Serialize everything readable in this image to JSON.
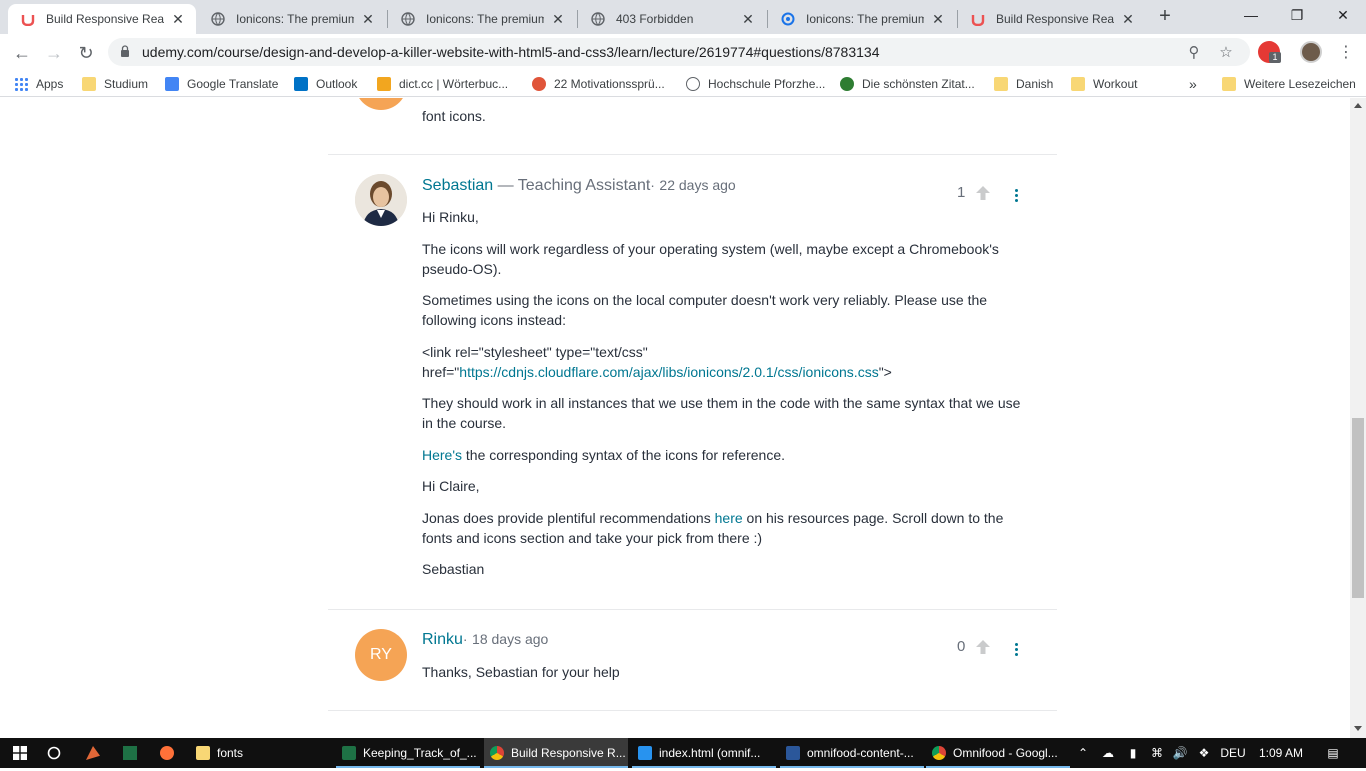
{
  "browser": {
    "tabs": [
      {
        "title": "Build Responsive Real W",
        "icon": "udemy-icon",
        "active": true
      },
      {
        "title": "Ionicons: The premium",
        "icon": "globe-icon",
        "active": false
      },
      {
        "title": "Ionicons: The premium",
        "icon": "globe-icon",
        "active": false
      },
      {
        "title": "403 Forbidden",
        "icon": "globe-icon",
        "active": false
      },
      {
        "title": "Ionicons: The premium",
        "icon": "loading-icon",
        "active": false
      },
      {
        "title": "Build Responsive Real W",
        "icon": "udemy-icon",
        "active": false
      }
    ],
    "url": "udemy.com/course/design-and-develop-a-killer-website-with-html5-and-css3/learn/lecture/2619774#questions/8783134",
    "extension_badge": "1",
    "bookmarks": [
      {
        "label": "Apps",
        "icon": "apps-grid-icon"
      },
      {
        "label": "Studium",
        "icon": "folder-icon"
      },
      {
        "label": "Google Translate",
        "icon": "google-translate-icon"
      },
      {
        "label": "Outlook",
        "icon": "outlook-icon"
      },
      {
        "label": "dict.cc | Wörterbuc...",
        "icon": "dictcc-icon"
      },
      {
        "label": "22 Motivationssprü...",
        "icon": "motivation-icon"
      },
      {
        "label": "Hochschule Pforzhe...",
        "icon": "globe-icon"
      },
      {
        "label": "Die schönsten Zitat...",
        "icon": "zitate-icon"
      },
      {
        "label": "Danish",
        "icon": "folder-icon"
      },
      {
        "label": "Workout",
        "icon": "folder-icon"
      }
    ],
    "bookmarks_overflow": "»",
    "other_bookmarks": "Weitere Lesezeichen"
  },
  "thread": {
    "prev_tail": "font icons.",
    "replies": [
      {
        "author": "Sebastian",
        "role": " — Teaching Assistant",
        "dot": "·",
        "time": "22 days ago",
        "votes": "1",
        "paragraphs": {
          "p1": "Hi Rinku,",
          "p2": "The icons will work regardless of your operating system (well, maybe except a Chromebook's pseudo-OS).",
          "p3": "Sometimes using the icons on the local computer doesn't work very reliably. Please use the following icons instead:",
          "p4_pre": "<link rel=\"stylesheet\" type=\"text/css\" href=\"",
          "p4_link": "https://cdnjs.cloudflare.com/ajax/libs/ionicons/2.0.1/css/ionicons.css",
          "p4_post": "\">",
          "p5": "They should work in all instances that we use them in the code with the same syntax that we use in the course.",
          "p6_link": "Here's",
          "p6_post": " the corresponding syntax of the icons for reference.",
          "p7": "Hi Claire,",
          "p8_pre": "Jonas does provide plentiful recommendations ",
          "p8_link": "here",
          "p8_post": " on his resources page. Scroll down to the fonts and icons section and take your pick from there :)",
          "p9": "Sebastian"
        }
      },
      {
        "author": "Rinku",
        "initials": "RY",
        "dot": "·",
        "time": "18 days ago",
        "votes": "0",
        "text": "Thanks, Sebastian for your help"
      }
    ]
  },
  "taskbar": {
    "items": [
      {
        "label": "fonts",
        "icon": "folder-icon"
      },
      {
        "label": "Keeping_Track_of_...",
        "icon": "excel-icon"
      },
      {
        "label": "Build Responsive R...",
        "icon": "chrome-icon",
        "active": true
      },
      {
        "label": "index.html (omnif...",
        "icon": "brackets-icon"
      },
      {
        "label": "omnifood-content-...",
        "icon": "word-icon"
      },
      {
        "label": "Omnifood - Googl...",
        "icon": "chrome-icon"
      }
    ],
    "language": "DEU",
    "time": "1:09 AM"
  },
  "colors": {
    "link": "#007791",
    "avatar_orange": "#f5a455",
    "text": "#29303b",
    "muted": "#686f7a"
  }
}
